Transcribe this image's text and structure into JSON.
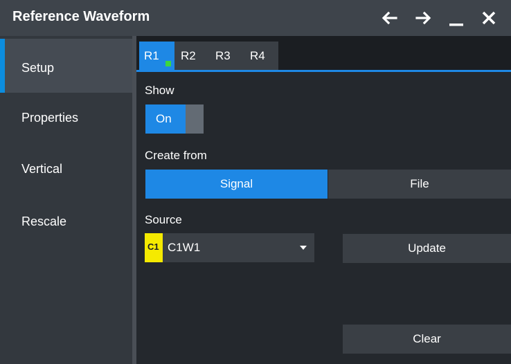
{
  "window": {
    "title": "Reference Waveform",
    "controls": {
      "back_icon": "arrow-left-icon",
      "forward_icon": "arrow-right-icon",
      "minimize_icon": "minimize-icon",
      "close_icon": "close-icon"
    }
  },
  "sidebar": {
    "items": [
      {
        "label": "Setup",
        "active": true
      },
      {
        "label": "Properties",
        "active": false
      },
      {
        "label": "Vertical",
        "active": false
      },
      {
        "label": "Rescale",
        "active": false
      }
    ]
  },
  "tabs": [
    {
      "label": "R1",
      "active": true,
      "indicator_color": "#3cd640"
    },
    {
      "label": "R2",
      "active": false
    },
    {
      "label": "R3",
      "active": false
    },
    {
      "label": "R4",
      "active": false
    }
  ],
  "show": {
    "label": "Show",
    "toggle_value": "On",
    "state": true
  },
  "create_from": {
    "label": "Create from",
    "options": [
      "Signal",
      "File"
    ],
    "selected": "Signal"
  },
  "source": {
    "label": "Source",
    "badge": "C1",
    "badge_color": "#f5ea00",
    "value": "C1W1",
    "dropdown_icon": "caret-down-icon"
  },
  "buttons": {
    "update": "Update",
    "clear": "Clear"
  },
  "colors": {
    "accent": "#1e88e5",
    "titlebar": "#3e444b",
    "sidebar": "#33383e",
    "content": "#24282d",
    "control": "#3a3f45"
  }
}
